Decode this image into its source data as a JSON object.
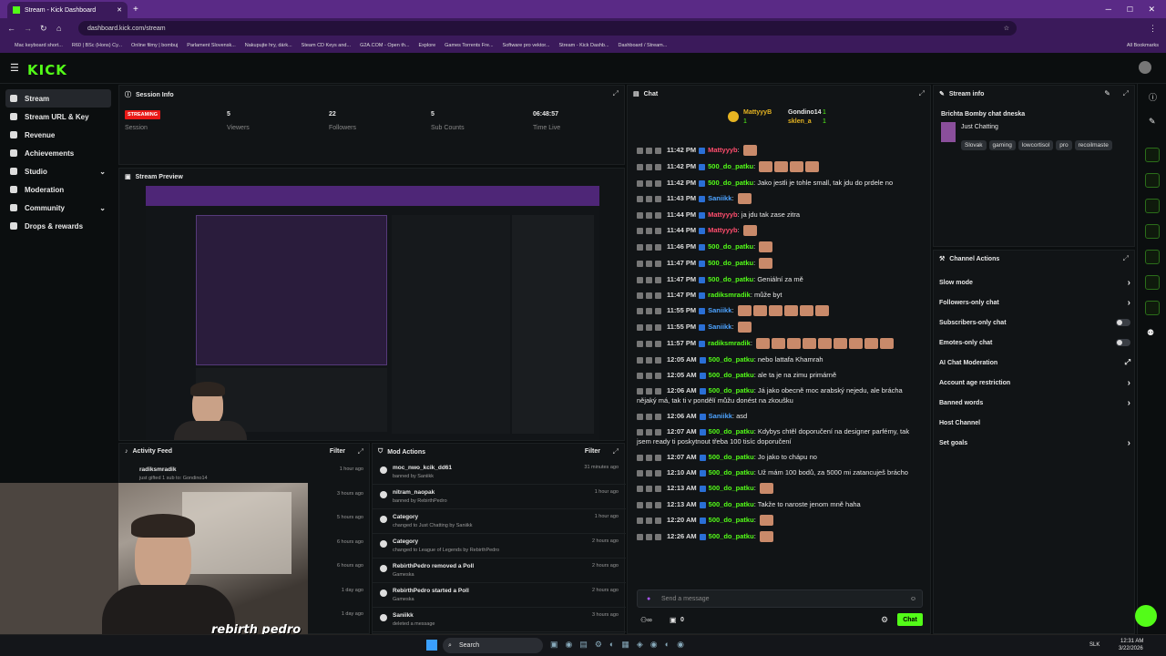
{
  "browser": {
    "tab_title": "Stream - Kick Dashboard",
    "url": "dashboard.kick.com/stream",
    "bookmarks": [
      "Mac keyboard short...",
      "R60 | BSc (Hons) Cy...",
      "Online filmy | bombuj",
      "Parlament Slovensk...",
      "Nakupujte hry, dárk...",
      "Steam CD Keys and...",
      "G2A.COM - Open th...",
      "Explore",
      "Games Torrents Fre...",
      "Software pro vektor...",
      "Stream - Kick Dashb...",
      "Dashboard / Stream..."
    ],
    "all_bookmarks": "All Bookmarks"
  },
  "app": {
    "logo": "KICK"
  },
  "sidebar": {
    "items": [
      {
        "label": "Stream",
        "icon": "home-icon"
      },
      {
        "label": "Stream URL & Key",
        "icon": "key-icon"
      },
      {
        "label": "Revenue",
        "icon": "dollar-icon"
      },
      {
        "label": "Achievements",
        "icon": "trophy-icon"
      },
      {
        "label": "Studio",
        "icon": "brush-icon"
      },
      {
        "label": "Moderation",
        "icon": "wrench-icon"
      },
      {
        "label": "Community",
        "icon": "globe-icon"
      },
      {
        "label": "Drops & rewards",
        "icon": "gift-icon"
      }
    ]
  },
  "session": {
    "title": "Session Info",
    "status": "STREAMING",
    "session_label": "Session",
    "stats": [
      {
        "value": "5",
        "label": "Viewers"
      },
      {
        "value": "22",
        "label": "Followers"
      },
      {
        "value": "5",
        "label": "Sub Counts"
      },
      {
        "value": "06:48:57",
        "label": "Time Live"
      }
    ]
  },
  "preview": {
    "title": "Stream Preview"
  },
  "activity": {
    "title": "Activity Feed",
    "filter": "Filter",
    "items": [
      {
        "user": "radiksmradik",
        "sub": "just gifted 1 sub to: Gondino14",
        "time": "1 hour ago"
      },
      {
        "time": "3 hours ago"
      },
      {
        "time": "5 hours ago"
      },
      {
        "time": "6 hours ago"
      },
      {
        "time": "6 hours ago"
      },
      {
        "time": "1 day ago"
      },
      {
        "time": "1 day ago"
      }
    ]
  },
  "mod": {
    "title": "Mod Actions",
    "filter": "Filter",
    "items": [
      {
        "main": "moc_nwo_kcik_dd61",
        "sub": "banned by Saniikk",
        "time": "31 minutes ago"
      },
      {
        "main": "nitram_naopak",
        "sub": "banned by RebirthPedro",
        "time": "1 hour ago"
      },
      {
        "main": "Category",
        "sub": "changed to Just Chatting by Saniikk",
        "time": "1 hour ago"
      },
      {
        "main": "Category",
        "sub": "changed to League of Legends by RebirthPedro",
        "time": "2 hours ago"
      },
      {
        "main": "RebirthPedro removed a Poll",
        "sub": "Gameska",
        "time": "2 hours ago"
      },
      {
        "main": "RebirthPedro started a Poll",
        "sub": "Gameska",
        "time": "2 hours ago"
      },
      {
        "main": "Saniikk",
        "sub": "deleted a message",
        "time": "3 hours ago"
      }
    ]
  },
  "chat": {
    "title": "Chat",
    "top": [
      {
        "name": "MattyyyB",
        "count": "1"
      },
      {
        "name": "Gondino14",
        "count": "1"
      },
      {
        "name": "sklen_a",
        "count": "1"
      }
    ],
    "messages": [
      {
        "time": "11:42 PM",
        "user": "Mattyyyb",
        "color": "#ff4d6d",
        "text": "",
        "emotes": 1
      },
      {
        "time": "11:42 PM",
        "user": "500_do_patku",
        "color": "#53fc18",
        "text": "",
        "emotes": 4
      },
      {
        "time": "11:42 PM",
        "user": "500_do_patku",
        "color": "#53fc18",
        "text": "Jako jestli je tohle small, tak jdu do prdele no",
        "emotes": 0
      },
      {
        "time": "11:43 PM",
        "user": "Saniikk",
        "color": "#4da3ff",
        "text": "",
        "emotes": 1
      },
      {
        "time": "11:44 PM",
        "user": "Mattyyyb",
        "color": "#ff4d6d",
        "text": "ja jdu tak zase zitra",
        "emotes": 0
      },
      {
        "time": "11:44 PM",
        "user": "Mattyyyb",
        "color": "#ff4d6d",
        "text": "",
        "emotes": 1
      },
      {
        "time": "11:46 PM",
        "user": "500_do_patku",
        "color": "#53fc18",
        "text": "",
        "emotes": 1
      },
      {
        "time": "11:47 PM",
        "user": "500_do_patku",
        "color": "#53fc18",
        "text": "",
        "emotes": 1
      },
      {
        "time": "11:47 PM",
        "user": "500_do_patku",
        "color": "#53fc18",
        "text": "Geniální za mě",
        "emotes": 0
      },
      {
        "time": "11:47 PM",
        "user": "radiksmradik",
        "color": "#53fc18",
        "text": "může byt",
        "emotes": 0
      },
      {
        "time": "11:55 PM",
        "user": "Saniikk",
        "color": "#4da3ff",
        "text": "",
        "emotes": 6
      },
      {
        "time": "11:55 PM",
        "user": "Saniikk",
        "color": "#4da3ff",
        "text": "",
        "emotes": 1
      },
      {
        "time": "11:57 PM",
        "user": "radiksmradik",
        "color": "#53fc18",
        "text": "",
        "emotes": 9
      },
      {
        "time": "12:05 AM",
        "user": "500_do_patku",
        "color": "#53fc18",
        "text": "nebo lattafa Khamrah",
        "emotes": 0
      },
      {
        "time": "12:05 AM",
        "user": "500_do_patku",
        "color": "#53fc18",
        "text": "ale ta je na zimu primárně",
        "emotes": 0
      },
      {
        "time": "12:06 AM",
        "user": "500_do_patku",
        "color": "#53fc18",
        "text": "Já jako obecně moc arabský nejedu, ale brácha nějaký má, tak ti v pondělí můžu donést na zkoušku",
        "emotes": 0
      },
      {
        "time": "12:06 AM",
        "user": "Saniikk",
        "color": "#4da3ff",
        "text": "asd",
        "emotes": 0
      },
      {
        "time": "12:07 AM",
        "user": "500_do_patku",
        "color": "#53fc18",
        "text": "Kdybys chtěl doporučení na designer parfémy, tak jsem ready ti poskytnout třeba 100 tisíc doporučení",
        "emotes": 0
      },
      {
        "time": "12:07 AM",
        "user": "500_do_patku",
        "color": "#53fc18",
        "text": "Jo jako to chápu no",
        "emotes": 0
      },
      {
        "time": "12:10 AM",
        "user": "500_do_patku",
        "color": "#53fc18",
        "text": "Už mám 100 bodů, za 5000 mi zatancuješ brácho",
        "emotes": 0
      },
      {
        "time": "12:13 AM",
        "user": "500_do_patku",
        "color": "#53fc18",
        "text": "",
        "emotes": 1
      },
      {
        "time": "12:13 AM",
        "user": "500_do_patku",
        "color": "#53fc18",
        "text": "Takže to naroste jenom mně haha",
        "emotes": 0
      },
      {
        "time": "12:20 AM",
        "user": "500_do_patku",
        "color": "#53fc18",
        "text": "",
        "emotes": 1
      },
      {
        "time": "12:26 AM",
        "user": "500_do_patku",
        "color": "#53fc18",
        "text": "",
        "emotes": 1
      }
    ],
    "placeholder": "Send a message",
    "viewers_icon": "0",
    "send": "Chat"
  },
  "streaminfo": {
    "title": "Stream info",
    "stream_title": "Brichta Bomby chat dneska",
    "category": "Just Chatting",
    "tags": [
      "Slovak",
      "gaming",
      "lowcortisol",
      "pro",
      "recoilmaste"
    ]
  },
  "actions": {
    "title": "Channel Actions",
    "items": [
      {
        "label": "Slow mode",
        "ctl": "arrow"
      },
      {
        "label": "Followers-only chat",
        "ctl": "arrow"
      },
      {
        "label": "Subscribers-only chat",
        "ctl": "toggle"
      },
      {
        "label": "Emotes-only chat",
        "ctl": "toggle"
      },
      {
        "label": "AI Chat Moderation",
        "ctl": "ext"
      },
      {
        "label": "Account age restriction",
        "ctl": "arrow"
      },
      {
        "label": "Banned words",
        "ctl": "arrow"
      },
      {
        "label": "Host Channel",
        "ctl": "none"
      },
      {
        "label": "Set goals",
        "ctl": "arrow"
      }
    ]
  },
  "taskbar": {
    "search": "Search",
    "lang": "SLK",
    "time": "12:31 AM",
    "date": "3/22/2026"
  },
  "watermark": "rebirth pedro"
}
